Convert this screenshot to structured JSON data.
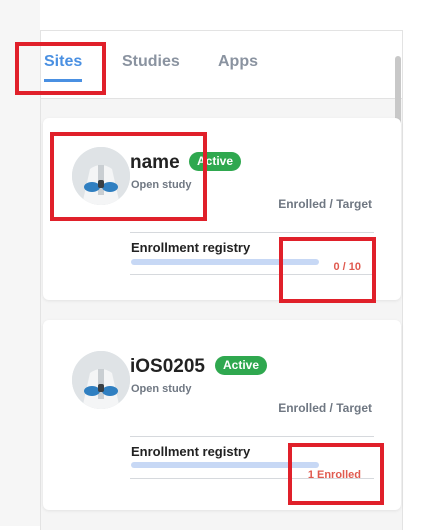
{
  "tabs": [
    {
      "label": "Sites",
      "active": true
    },
    {
      "label": "Studies",
      "active": false
    },
    {
      "label": "Apps",
      "active": false
    }
  ],
  "sites": [
    {
      "name": "name",
      "status": "Active",
      "study_type": "Open study",
      "enrollment_header": "Enrolled / Target",
      "registry_label": "Enrollment registry",
      "enrollment_value": "0 / 10"
    },
    {
      "name": "iOS0205",
      "status": "Active",
      "study_type": "Open study",
      "enrollment_header": "Enrolled / Target",
      "registry_label": "Enrollment registry",
      "enrollment_value": "1 Enrolled"
    }
  ],
  "colors": {
    "accent": "#4a90e2",
    "active_badge": "#2fa84f",
    "enrollment_value": "#e05a4f",
    "highlight_box": "#e0202a"
  }
}
